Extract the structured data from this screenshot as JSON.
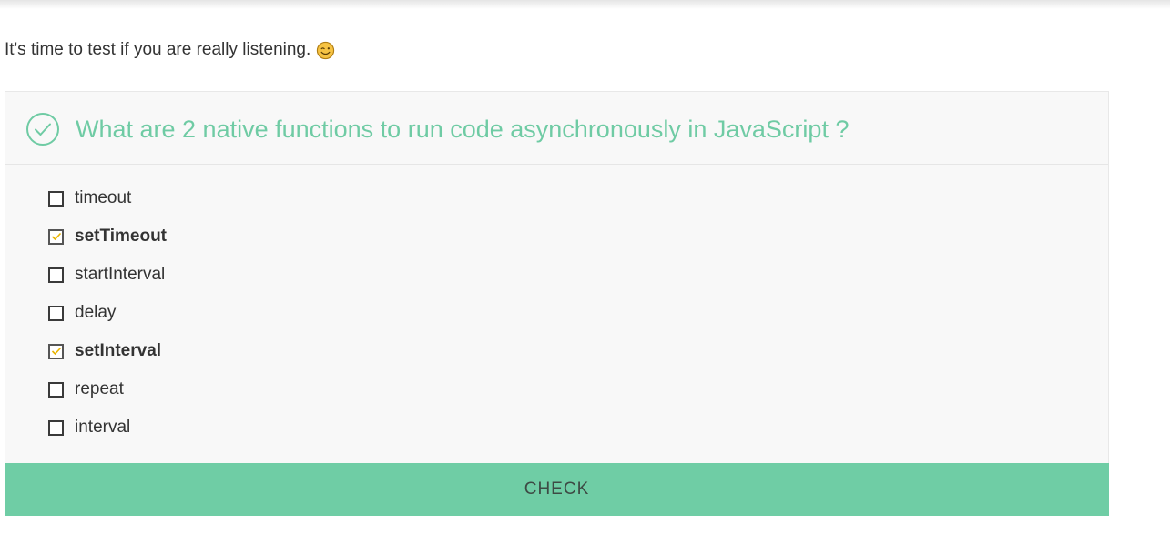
{
  "intro": {
    "text": "It's time to test if you are really listening.",
    "emoji_icon": "winking-face-icon"
  },
  "quiz": {
    "question": "What are 2 native functions to run code asynchronously in JavaScript ?",
    "status_icon": "check-circle-icon",
    "accent_color": "#6fcba4",
    "options": [
      {
        "label": "timeout",
        "checked": false
      },
      {
        "label": "setTimeout",
        "checked": true
      },
      {
        "label": "startInterval",
        "checked": false
      },
      {
        "label": "delay",
        "checked": false
      },
      {
        "label": "setInterval",
        "checked": true
      },
      {
        "label": "repeat",
        "checked": false
      },
      {
        "label": "interval",
        "checked": false
      }
    ],
    "check_button_label": "CHECK",
    "check_button_color": "#6fcda5",
    "tick_color": "#e8b400"
  }
}
